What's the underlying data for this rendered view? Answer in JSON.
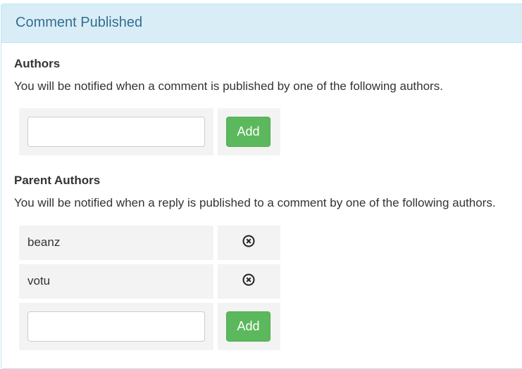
{
  "panel": {
    "title": "Comment Published"
  },
  "authors_section": {
    "title": "Authors",
    "description": "You will be notified when a comment is published by one of the following authors.",
    "input_value": "",
    "add_label": "Add"
  },
  "parent_authors_section": {
    "title": "Parent Authors",
    "description": "You will be notified when a reply is published to a comment by one of the following authors.",
    "items": [
      {
        "name": "beanz",
        "remove_icon": "remove-circle-icon"
      },
      {
        "name": "votu",
        "remove_icon": "remove-circle-icon"
      }
    ],
    "input_value": "",
    "add_label": "Add"
  },
  "colors": {
    "heading_bg": "#d9edf7",
    "heading_text": "#31708f",
    "add_button": "#5cb85c",
    "cell_bg": "#f3f3f3"
  }
}
